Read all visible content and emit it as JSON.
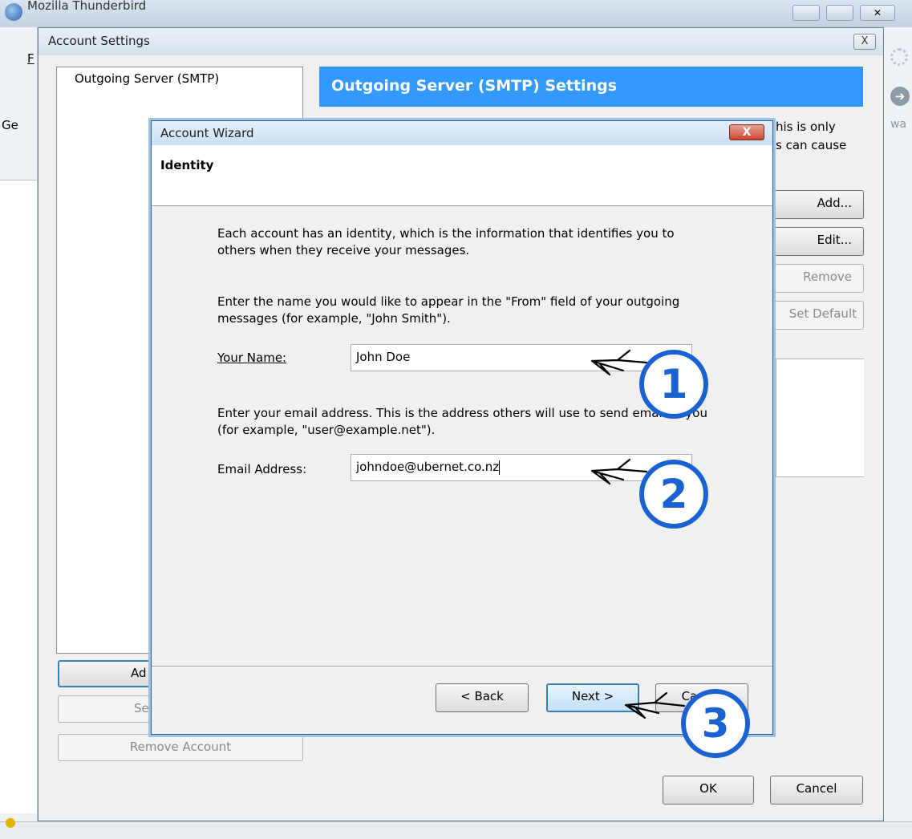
{
  "main_window": {
    "title": "Mozilla Thunderbird",
    "menu_fragment": "F",
    "toolbar_fragment_left": "Ge",
    "toolbar_fragment_right": "wa"
  },
  "account_settings": {
    "title": "Account Settings",
    "close_label": "X",
    "account_list": [
      "Outgoing Server (SMTP)"
    ],
    "buttons": {
      "add_account_fragment": "Ad",
      "set_default_fragment": "Se",
      "remove_account": "Remove Account",
      "ok": "OK",
      "cancel": "Cancel"
    },
    "smtp": {
      "header": "Outgoing Server (SMTP) Settings",
      "desc_fragment_1": "his is only",
      "desc_fragment_2": "s can cause",
      "add": "Add...",
      "edit": "Edit...",
      "remove": "Remove",
      "set_default": "Set Default"
    }
  },
  "wizard": {
    "title": "Account Wizard",
    "close_label": "X",
    "page_title": "Identity",
    "intro": "Each account has an identity, which is the information that identifies you to others when they receive your messages.",
    "name_help": "Enter the name you would like to appear in the \"From\" field of your outgoing messages (for example, \"John Smith\").",
    "name_label": "Your Name:",
    "name_value": "John Doe",
    "email_help": "Enter your email address. This is the address others will use to send email to you (for example, \"user@example.net\").",
    "email_label": "Email Address:",
    "email_value": "johndoe@ubernet.co.nz",
    "back_label": "< Back",
    "next_label": "Next >",
    "cancel_label": "Cancel"
  },
  "annotations": [
    "1",
    "2",
    "3"
  ]
}
